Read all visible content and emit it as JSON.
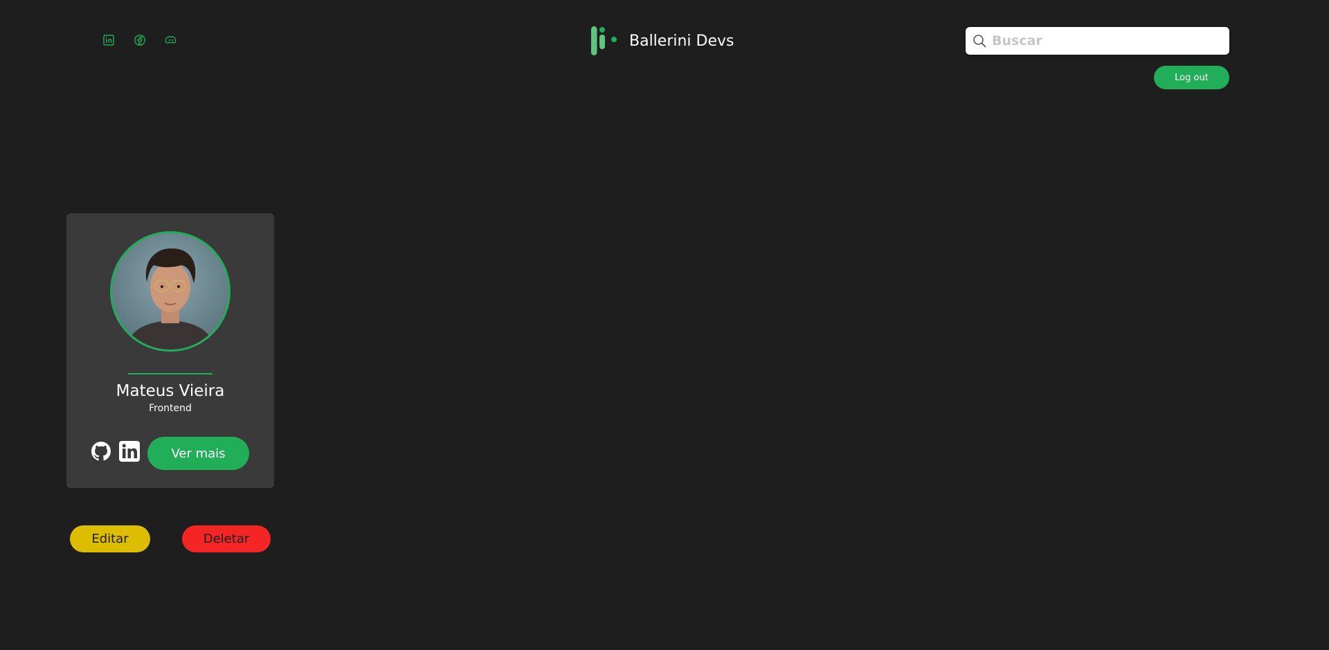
{
  "header": {
    "social_links": [
      {
        "icon": "linkedin-icon"
      },
      {
        "icon": "facebook-icon"
      },
      {
        "icon": "discord-icon"
      }
    ],
    "brand": {
      "name": "Ballerini Devs",
      "logo_icon": "ballerini-logo"
    },
    "search": {
      "placeholder": "Buscar",
      "value": "",
      "icon": "search-icon"
    },
    "logout_label": "Log out"
  },
  "member_card": {
    "name": "Mateus Vieira",
    "role": "Frontend",
    "links": [
      {
        "icon": "github-icon"
      },
      {
        "icon": "linkedin-icon"
      }
    ],
    "ver_mais_label": "Ver mais"
  },
  "actions": {
    "edit_label": "Editar",
    "delete_label": "Deletar"
  },
  "colors": {
    "background": "#1e1e1e",
    "card": "#3a3a3a",
    "accent": "#22ad59",
    "edit": "#ddbd00",
    "delete": "#f42525"
  }
}
